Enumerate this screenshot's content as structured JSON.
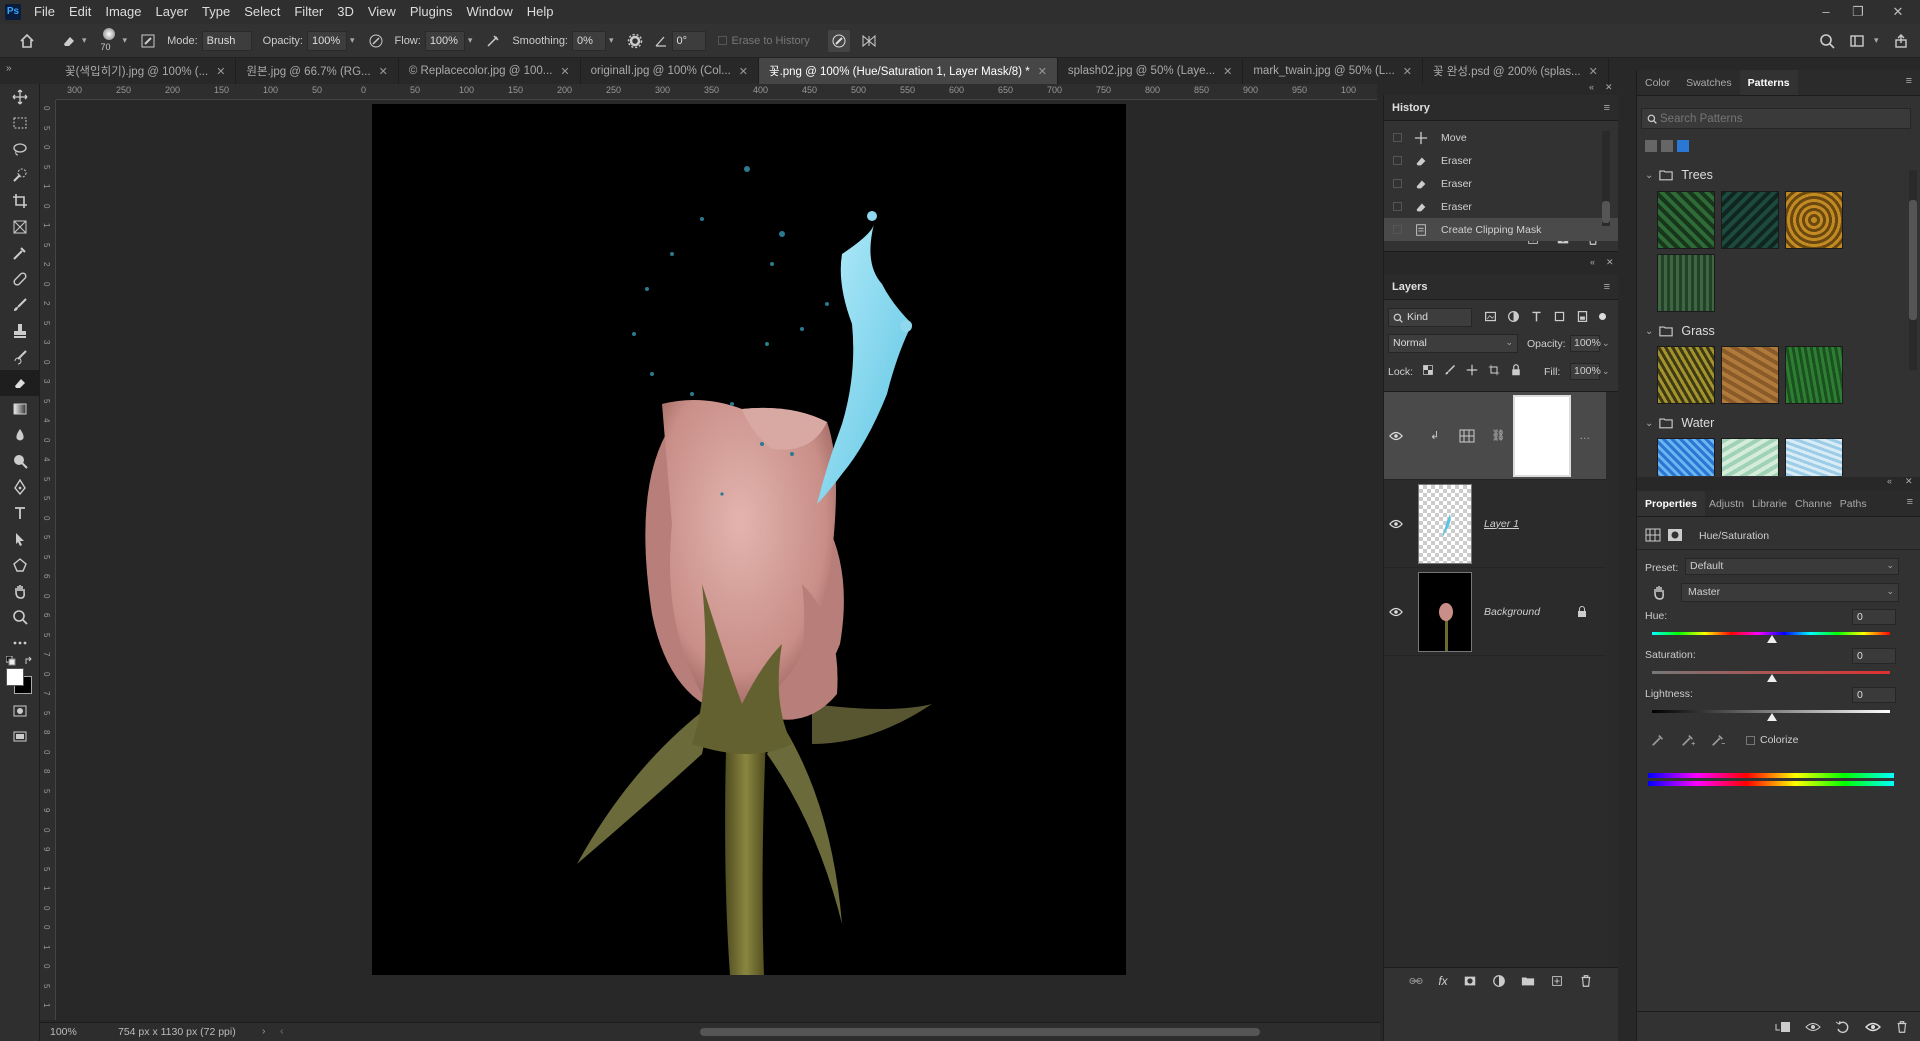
{
  "app": {
    "logo": "Ps"
  },
  "menu": [
    "File",
    "Edit",
    "Image",
    "Layer",
    "Type",
    "Select",
    "Filter",
    "3D",
    "View",
    "Plugins",
    "Window",
    "Help"
  ],
  "window_controls": {
    "minimize": "–",
    "restore": "❐",
    "close": "✕"
  },
  "options": {
    "brush_size": "70",
    "mode_label": "Mode:",
    "mode_value": "Brush",
    "opacity_label": "Opacity:",
    "opacity_value": "100%",
    "flow_label": "Flow:",
    "flow_value": "100%",
    "smoothing_label": "Smoothing:",
    "smoothing_value": "0%",
    "angle_value": "0°",
    "erase_history_label": "Erase to History"
  },
  "tabs": [
    {
      "label": "꽃(색입히기).jpg @ 100% (..."
    },
    {
      "label": "원본.jpg @ 66.7% (RG..."
    },
    {
      "label": "© Replacecolor.jpg @ 100..."
    },
    {
      "label": "originalI.jpg @ 100% (Col..."
    },
    {
      "label": "꽃.png @ 100% (Hue/Saturation 1, Layer Mask/8) *",
      "active": true
    },
    {
      "label": "splash02.jpg @ 50% (Laye..."
    },
    {
      "label": "mark_twain.jpg @ 50% (L..."
    },
    {
      "label": "꽃 완성.psd @ 200% (splas..."
    }
  ],
  "ruler": {
    "top": [
      "300",
      "250",
      "200",
      "150",
      "100",
      "50",
      "0",
      "50",
      "100",
      "150",
      "200",
      "250",
      "300",
      "350",
      "400",
      "450",
      "500",
      "550",
      "600",
      "650",
      "700",
      "750",
      "800",
      "850",
      "900",
      "950",
      "100"
    ],
    "left": [
      "0",
      "5",
      "0",
      "5",
      "1",
      "0",
      "1",
      "5",
      "2",
      "0",
      "2",
      "5",
      "3",
      "0",
      "3",
      "5",
      "4",
      "0",
      "4",
      "5",
      "5",
      "0",
      "5",
      "5",
      "6",
      "0",
      "6",
      "5",
      "7",
      "0",
      "7",
      "5",
      "8",
      "0",
      "8",
      "5",
      "9",
      "0",
      "9",
      "5",
      "1",
      "0",
      "0",
      "1",
      "0",
      "5",
      "1"
    ]
  },
  "status": {
    "zoom": "100%",
    "doc_info": "754 px x 1130 px (72 ppi)"
  },
  "history": {
    "title": "History",
    "items": [
      {
        "label": "Move",
        "icon": "move-icon"
      },
      {
        "label": "Eraser",
        "icon": "eraser-icon"
      },
      {
        "label": "Eraser",
        "icon": "eraser-icon"
      },
      {
        "label": "Eraser",
        "icon": "eraser-icon"
      },
      {
        "label": "Create Clipping Mask",
        "icon": "document-icon",
        "selected": true
      }
    ]
  },
  "layers": {
    "title": "Layers",
    "filter_kind": "Kind",
    "blend_mode": "Normal",
    "opacity_label": "Opacity:",
    "opacity_value": "100%",
    "lock_label": "Lock:",
    "fill_label": "Fill:",
    "fill_value": "100%",
    "items": [
      {
        "name": "",
        "type": "adjustment"
      },
      {
        "name": "Layer 1",
        "type": "pixel"
      },
      {
        "name": "Background",
        "type": "background",
        "locked": true
      }
    ]
  },
  "right_tabs": {
    "items": [
      "Color",
      "Swatches",
      "Patterns"
    ],
    "active": "Patterns"
  },
  "patterns": {
    "search_placeholder": "Search Patterns",
    "groups": [
      {
        "name": "Trees",
        "swatches": [
          "#2e6b36",
          "#1e4a3e",
          "#c28a22",
          "#3e6640"
        ]
      },
      {
        "name": "Grass",
        "swatches": [
          "#a29230",
          "#b07a3a",
          "#2d7e32"
        ]
      },
      {
        "name": "Water",
        "swatches": [
          "#2a78d4",
          "#9fd2b6",
          "#9ccce6"
        ]
      }
    ]
  },
  "properties": {
    "tabs": [
      "Properties",
      "Adjustn",
      "Librarie",
      "Channe",
      "Paths"
    ],
    "adjustment_name": "Hue/Saturation",
    "preset_label": "Preset:",
    "preset_value": "Default",
    "channel_value": "Master",
    "hue_label": "Hue:",
    "hue_value": "0",
    "saturation_label": "Saturation:",
    "saturation_value": "0",
    "lightness_label": "Lightness:",
    "lightness_value": "0",
    "colorize_label": "Colorize"
  },
  "colors": {
    "accent": "#31a8ff",
    "panel": "#323232",
    "canvas_bg": "#000000",
    "rose": "#d9a5a0",
    "splash": "#8fd8ee",
    "stem": "#6d6a30"
  }
}
